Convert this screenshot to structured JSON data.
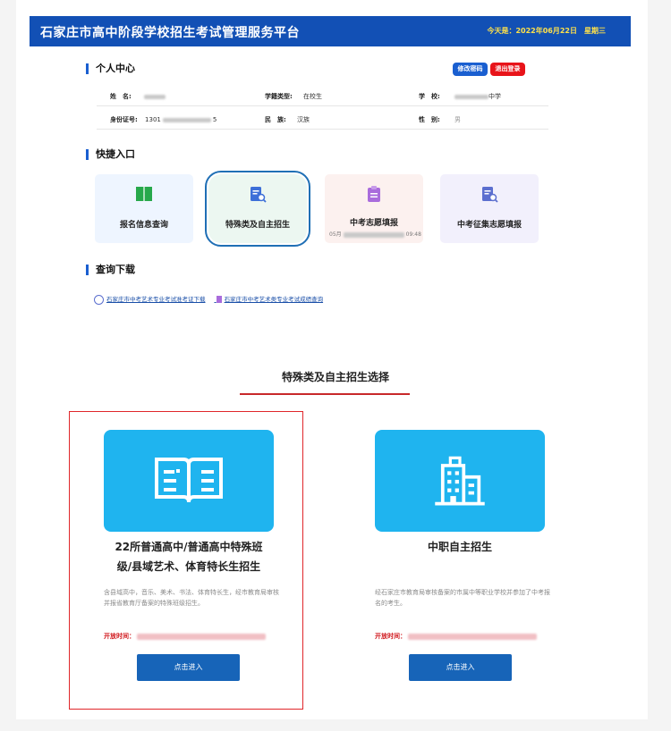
{
  "header": {
    "title": "石家庄市高中阶段学校招生考试管理服务平台",
    "today": "今天是：2022年06月22日",
    "weekday": "星期三"
  },
  "personal": {
    "section_title": "个人中心",
    "change_password": "修改密码",
    "logout": "退出登录",
    "name_label": "姓　名:",
    "status_label": "学籍类型:",
    "status_value": "在校生",
    "school_label": "学　校:",
    "school_value": "中学",
    "id_label": "身份证号:",
    "id_prefix": "1301",
    "id_suffix": "5",
    "ethnic_label": "民　族:",
    "ethnic_value": "汉族",
    "gender_label": "性　别:",
    "gender_value": "男"
  },
  "quick": {
    "section_title": "快捷入口",
    "items": [
      {
        "label": "报名信息查询",
        "icon": "book-icon"
      },
      {
        "label": "特殊类及自主招生",
        "icon": "document-search-icon"
      },
      {
        "label": "中考志愿填报",
        "icon": "clipboard-icon",
        "sub_left": "05月",
        "sub_right": "09:48"
      },
      {
        "label": "中考征集志愿填报",
        "icon": "document-search-icon"
      }
    ]
  },
  "download": {
    "section_title": "查询下载",
    "links": [
      "石家庄市中考艺术专业考试准考证下载",
      "石家庄市中考艺术类专业考试成绩查询"
    ]
  },
  "selection": {
    "title": "特殊类及自主招生选择",
    "options": [
      {
        "title_line1": "22所普通高中/普通高中特殊班",
        "title_line2": "级/县域艺术、体育特长生招生",
        "desc": "含县域高中，音乐、美术、书法、体育特长生，经市教育局审核并报省教育厅备案的特殊班级招生。",
        "open_label": "开放时间：",
        "button": "点击进入",
        "icon": "book-open-icon"
      },
      {
        "title_line1": "中职自主招生",
        "desc": "经石家庄市教育局审核备案的市属中等职业学校并参加了中考报名的考生。",
        "open_label": "开放时间：",
        "button": "点击进入",
        "icon": "building-icon"
      }
    ]
  },
  "colors": {
    "header": "#1250b5",
    "accent_red": "#c8282a",
    "card_blue": "#1fb4ef",
    "button_blue": "#1764b8"
  }
}
